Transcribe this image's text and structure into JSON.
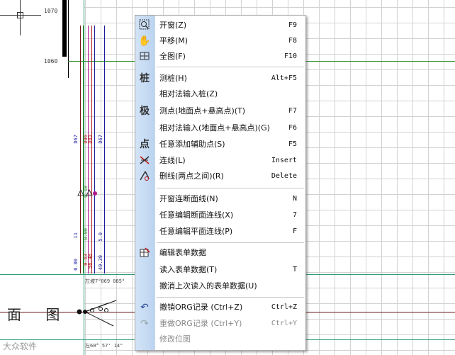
{
  "canvas": {
    "elevation_ticks": [
      "1070",
      "1060"
    ],
    "section_label": "面 图",
    "station_label_top": "左坡7°069 085°",
    "station_label_bottom": "左60° 57' 14\"",
    "vertical_labels": [
      "D67",
      "D86",
      "D85",
      "D67",
      "0.00",
      "0.63",
      "98.48",
      "49.39",
      "11",
      "0.00",
      "5.0",
      "0.18"
    ],
    "watermark": "大众软件"
  },
  "context_menu": {
    "items": [
      {
        "icon": "zoom-window-icon",
        "label": "开窗(Z)",
        "shortcut": "F9"
      },
      {
        "icon": "pan-hand-icon",
        "label": "平移(M)",
        "shortcut": "F8"
      },
      {
        "icon": "full-extent-icon",
        "label": "全图(F)",
        "shortcut": "F10"
      },
      {
        "icon": "stake-icon",
        "icon_text": "桩",
        "label": "测桩(H)",
        "shortcut": "Alt+F5"
      },
      {
        "icon": "none",
        "label": "相对法输入桩(Z)",
        "shortcut": ""
      },
      {
        "icon": "pole-icon",
        "icon_text": "极",
        "label": "测点(地面点+悬高点)(T)",
        "shortcut": "F7"
      },
      {
        "icon": "none",
        "label": "相对法输入(地面点+悬高点)(G)",
        "shortcut": "F6"
      },
      {
        "icon": "point-icon",
        "icon_text": "点",
        "label": "任意添加辅助点(S)",
        "shortcut": "F5"
      },
      {
        "icon": "connect-line-icon",
        "label": "连线(L)",
        "shortcut": "Insert"
      },
      {
        "icon": "delete-line-icon",
        "label": "删线(两点之间)(R)",
        "shortcut": "Delete"
      },
      {
        "icon": "none",
        "label": "开窗连断面线(N)",
        "shortcut": "N"
      },
      {
        "icon": "none",
        "label": "任意编辑断面连线(X)",
        "shortcut": "7"
      },
      {
        "icon": "none",
        "label": "任意编辑平面连线(P)",
        "shortcut": "F"
      },
      {
        "icon": "edit-table-icon",
        "label": "编辑表单数据",
        "shortcut": ""
      },
      {
        "icon": "none",
        "label": "读入表单数据(T)",
        "shortcut": "T"
      },
      {
        "icon": "none",
        "label": "撤消上次读入的表单数据(U)",
        "shortcut": ""
      },
      {
        "icon": "undo-icon",
        "label": "撤销ORG记录  (Ctrl+Z)",
        "shortcut": "Ctrl+Z"
      },
      {
        "icon": "redo-icon",
        "label": "重做ORG记录  (Ctrl+Y)",
        "shortcut": "Ctrl+Y",
        "disabled": true
      },
      {
        "icon": "none",
        "label": "修改位图",
        "shortcut": "",
        "disabled": true
      }
    ]
  }
}
